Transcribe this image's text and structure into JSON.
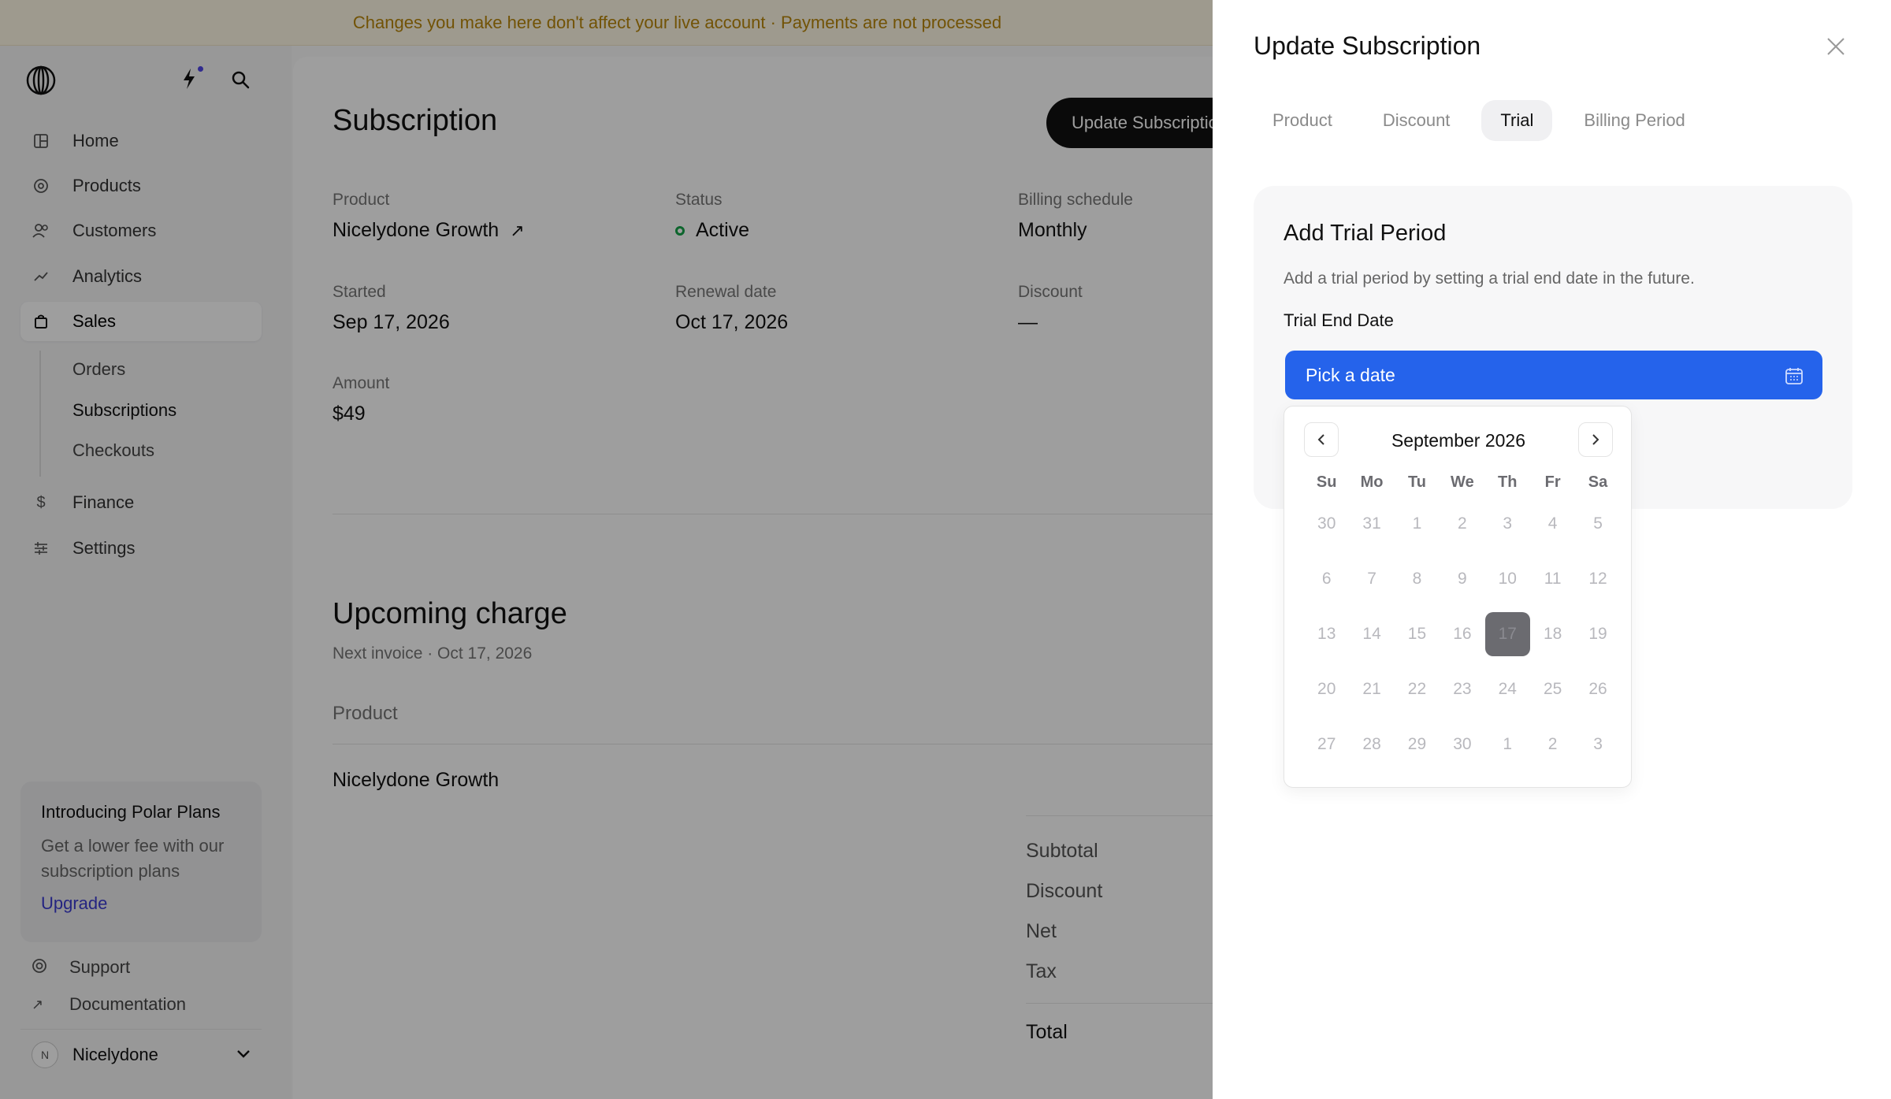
{
  "banner": {
    "text": "Changes you make here don't affect your live account · Payments are not processed"
  },
  "sidebar": {
    "nav": [
      {
        "label": "Home",
        "icon": "home-icon"
      },
      {
        "label": "Products",
        "icon": "products-icon"
      },
      {
        "label": "Customers",
        "icon": "customers-icon"
      },
      {
        "label": "Analytics",
        "icon": "analytics-icon"
      },
      {
        "label": "Sales",
        "icon": "bag-icon"
      },
      {
        "label": "Finance",
        "icon": "dollar-icon"
      },
      {
        "label": "Settings",
        "icon": "sliders-icon"
      }
    ],
    "sub": [
      {
        "label": "Orders"
      },
      {
        "label": "Subscriptions"
      },
      {
        "label": "Checkouts"
      }
    ],
    "promo": {
      "title": "Introducing Polar Plans",
      "body": "Get a lower fee with our subscription plans",
      "link": "Upgrade"
    },
    "footer": [
      {
        "label": "Support",
        "icon": "support-icon"
      },
      {
        "label": "Documentation",
        "icon": "external-arrow-icon"
      }
    ],
    "org": {
      "initial": "N",
      "name": "Nicelydone"
    }
  },
  "main": {
    "title": "Subscription",
    "update_button": "Update Subscription",
    "fields": {
      "product": {
        "label": "Product",
        "value": "Nicelydone Growth"
      },
      "status": {
        "label": "Status",
        "value": "Active"
      },
      "billing": {
        "label": "Billing schedule",
        "value": "Monthly"
      },
      "started": {
        "label": "Started",
        "value": "Sep 17, 2026"
      },
      "renewal": {
        "label": "Renewal date",
        "value": "Oct 17, 2026"
      },
      "discount": {
        "label": "Discount",
        "value": "—"
      },
      "amount": {
        "label": "Amount",
        "value": "$49"
      }
    },
    "upcoming": {
      "title": "Upcoming charge",
      "next_invoice": "Next invoice · Oct 17, 2026",
      "col_product": "Product",
      "product": "Nicelydone Growth",
      "summary": [
        "Subtotal",
        "Discount",
        "Net",
        "Tax",
        "Total"
      ]
    }
  },
  "drawer": {
    "title": "Update Subscription",
    "tabs": [
      "Product",
      "Discount",
      "Trial",
      "Billing Period"
    ],
    "active_tab": "Trial",
    "card": {
      "title": "Add Trial Period",
      "description": "Add a trial period by setting a trial end date in the future.",
      "field_label": "Trial End Date",
      "date_placeholder": "Pick a date"
    },
    "calendar": {
      "month": "September 2026",
      "weekdays": [
        "Su",
        "Mo",
        "Tu",
        "We",
        "Th",
        "Fr",
        "Sa"
      ],
      "weeks": [
        [
          "30",
          "31",
          "1",
          "2",
          "3",
          "4",
          "5"
        ],
        [
          "6",
          "7",
          "8",
          "9",
          "10",
          "11",
          "12"
        ],
        [
          "13",
          "14",
          "15",
          "16",
          "17",
          "18",
          "19"
        ],
        [
          "20",
          "21",
          "22",
          "23",
          "24",
          "25",
          "26"
        ],
        [
          "27",
          "28",
          "29",
          "30",
          "1",
          "2",
          "3"
        ]
      ],
      "today": "17"
    }
  }
}
